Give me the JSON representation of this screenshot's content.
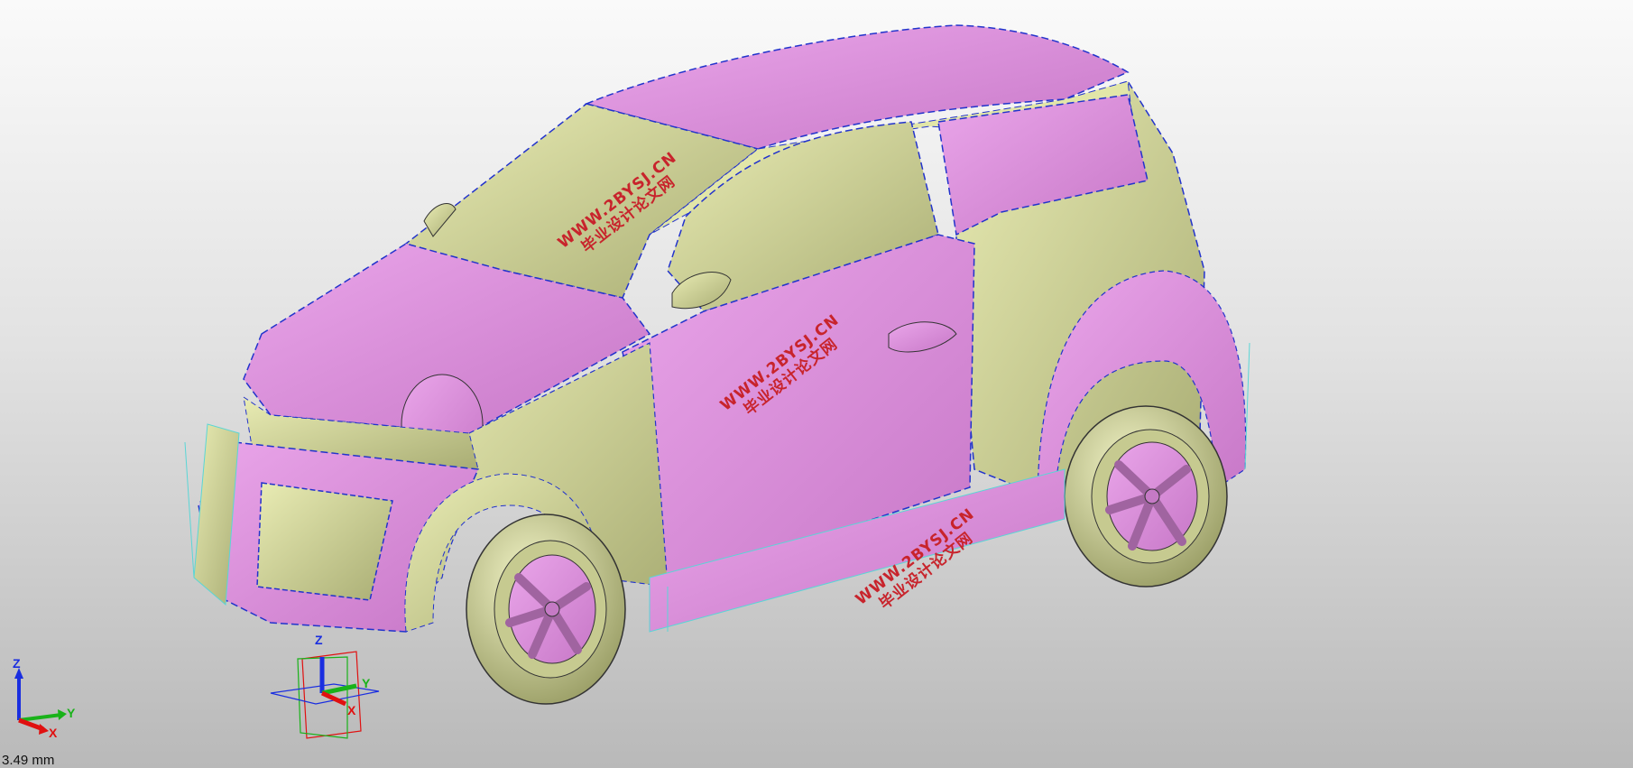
{
  "viewport": {
    "scale_label": "3.49 mm",
    "watermarks": [
      {
        "line1": "WWW.2BYSJ.CN",
        "line2": "毕业设计论文网"
      },
      {
        "line1": "WWW.2BYSJ.CN",
        "line2": "毕业设计论文网"
      },
      {
        "line1": "WWW.2BYSJ.CN",
        "line2": "毕业设计论文网"
      }
    ]
  },
  "triad": {
    "z_label": "Z",
    "y_label": "Y",
    "x_label": "X"
  },
  "origin_csys": {
    "z_label": "Z",
    "y_label": "Y",
    "x_label": "X"
  },
  "colors": {
    "body_pink": "#d88ad8",
    "body_olive": "#c3c78c",
    "edge_blue": "#2233cc",
    "edge_cyan": "#5ad6d6",
    "watermark_red": "#c8242c",
    "axis_x": "#e01010",
    "axis_y": "#19b219",
    "axis_z": "#1a2ee0"
  }
}
